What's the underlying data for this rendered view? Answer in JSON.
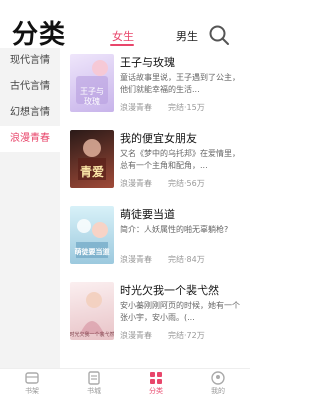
{
  "header": {
    "title": "分类",
    "tabs": [
      {
        "label": "女生",
        "active": true
      },
      {
        "label": "男生",
        "active": false
      }
    ],
    "search_icon": "search-icon"
  },
  "sidebar": {
    "items": [
      {
        "label": "现代言情",
        "active": false
      },
      {
        "label": "古代言情",
        "active": false
      },
      {
        "label": "幻想言情",
        "active": false
      },
      {
        "label": "浪漫青春",
        "active": true
      }
    ]
  },
  "books": [
    {
      "title": "王子与玫瑰",
      "desc": "童话故事里说，王子遇到了公主，他们就能幸福的生活...",
      "tag": "浪漫青春",
      "status": "完结·15万",
      "cover_text": "王子与玫瑰",
      "cover_color": "#d7c8ef"
    },
    {
      "title": "我的便宜女朋友",
      "desc": "又名《梦中的乌托邦》在爱情里，总有一个主角和配角，...",
      "tag": "浪漫青春",
      "status": "完结·56万",
      "cover_text": "青爱",
      "cover_color": "#8a3a2e"
    },
    {
      "title": "萌徒要当道",
      "desc": "简介：人妖属性的啪无辜躺枪?",
      "tag": "浪漫青春",
      "status": "完结·84万",
      "cover_text": "萌徒要当道",
      "cover_color": "#a8d8e8"
    },
    {
      "title": "时光欠我一个裴弋然",
      "desc": "安小蓁刚刚阿页的时候，她有一个张小宇，安小雨。(...",
      "tag": "浪漫青春",
      "status": "完结·72万",
      "cover_text": "时光欠我一个裴弋然",
      "cover_color": "#f2d7d9"
    }
  ],
  "bottom_nav": {
    "items": [
      {
        "label": "书架",
        "icon": "bookshelf-icon",
        "active": false
      },
      {
        "label": "书城",
        "icon": "bookstore-icon",
        "active": false
      },
      {
        "label": "分类",
        "icon": "category-icon",
        "active": true
      },
      {
        "label": "我的",
        "icon": "profile-icon",
        "active": false
      }
    ]
  },
  "colors": {
    "accent": "#e8466b",
    "sidebar_bg": "#f3f3f3"
  }
}
